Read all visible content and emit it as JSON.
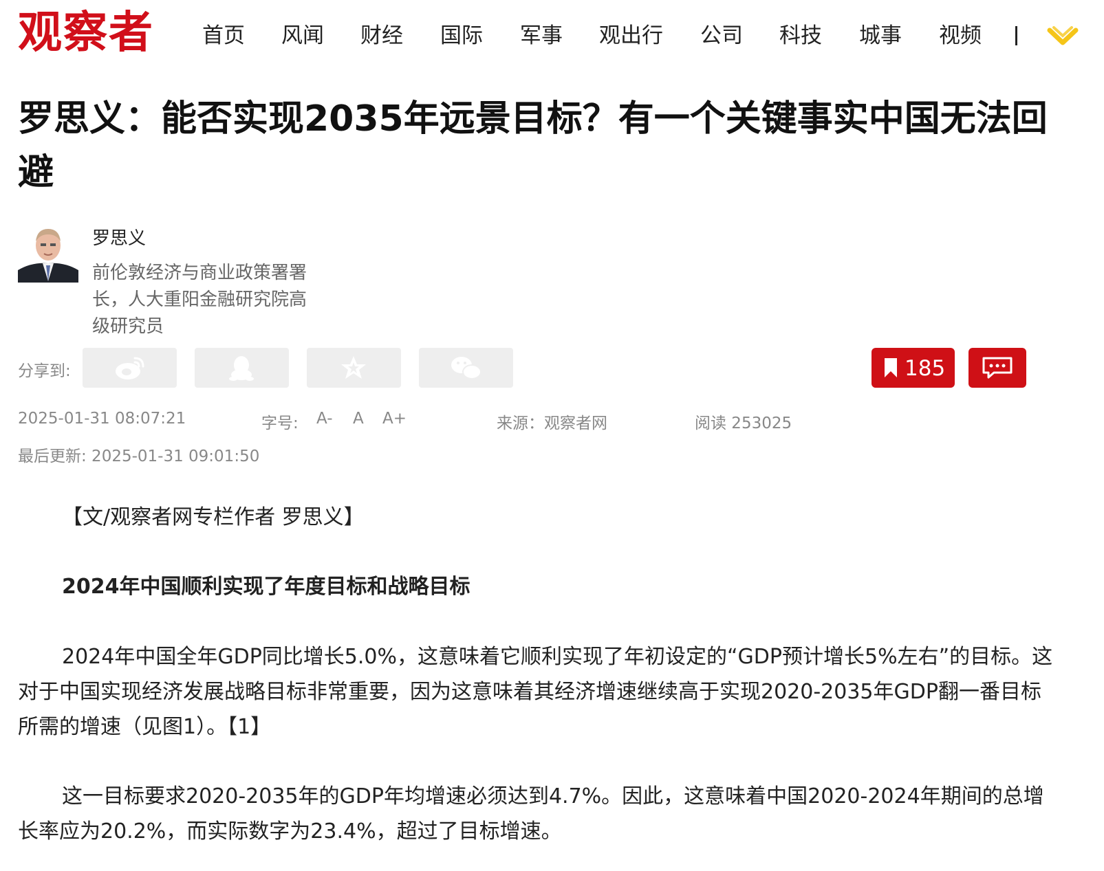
{
  "header": {
    "logo": "观察者",
    "nav": [
      "首页",
      "风闻",
      "财经",
      "国际",
      "军事",
      "观出行",
      "公司",
      "科技",
      "城事",
      "视频"
    ]
  },
  "article": {
    "title": "罗思义：能否实现2035年远景目标？有一个关键事实中国无法回避",
    "author": {
      "name": "罗思义",
      "bio": "前伦敦经济与商业政策署署长，人大重阳金融研究院高级研究员"
    },
    "share": {
      "label": "分享到:",
      "targets": [
        "weibo-icon",
        "qq-icon",
        "qzone-icon",
        "wechat-icon"
      ]
    },
    "collect_count": "185",
    "meta": {
      "published": "2025-01-31 08:07:21",
      "font_size_label": "字号:",
      "font_sizes": [
        "A-",
        "A",
        "A+"
      ],
      "source": "来源：观察者网",
      "reads": "阅读 253025",
      "updated": "最后更新: 2025-01-31 09:01:50"
    },
    "paragraphs": [
      "【文/观察者网专栏作者 罗思义】",
      "2024年中国顺利实现了年度目标和战略目标",
      "2024年中国全年GDP同比增长5.0%，这意味着它顺利实现了年初设定的“GDP预计增长5%左右”的目标。这对于中国实现经济发展战略目标非常重要，因为这意味着其经济增速继续高于实现2020-2035年GDP翻一番目标所需的增速（见图1）。【1】",
      "这一目标要求2020-2035年的GDP年均增速必须达到4.7%。因此，这意味着中国2020-2024年期间的总增长率应为20.2%，而实际数字为23.4%，超过了目标增速。"
    ]
  },
  "colors": {
    "brand_red": "#d10f1a",
    "button_red": "#cf1016",
    "share_gray": "#eeeeee",
    "meta_gray": "#888888",
    "nav_more_yellow": "#f5c518"
  }
}
